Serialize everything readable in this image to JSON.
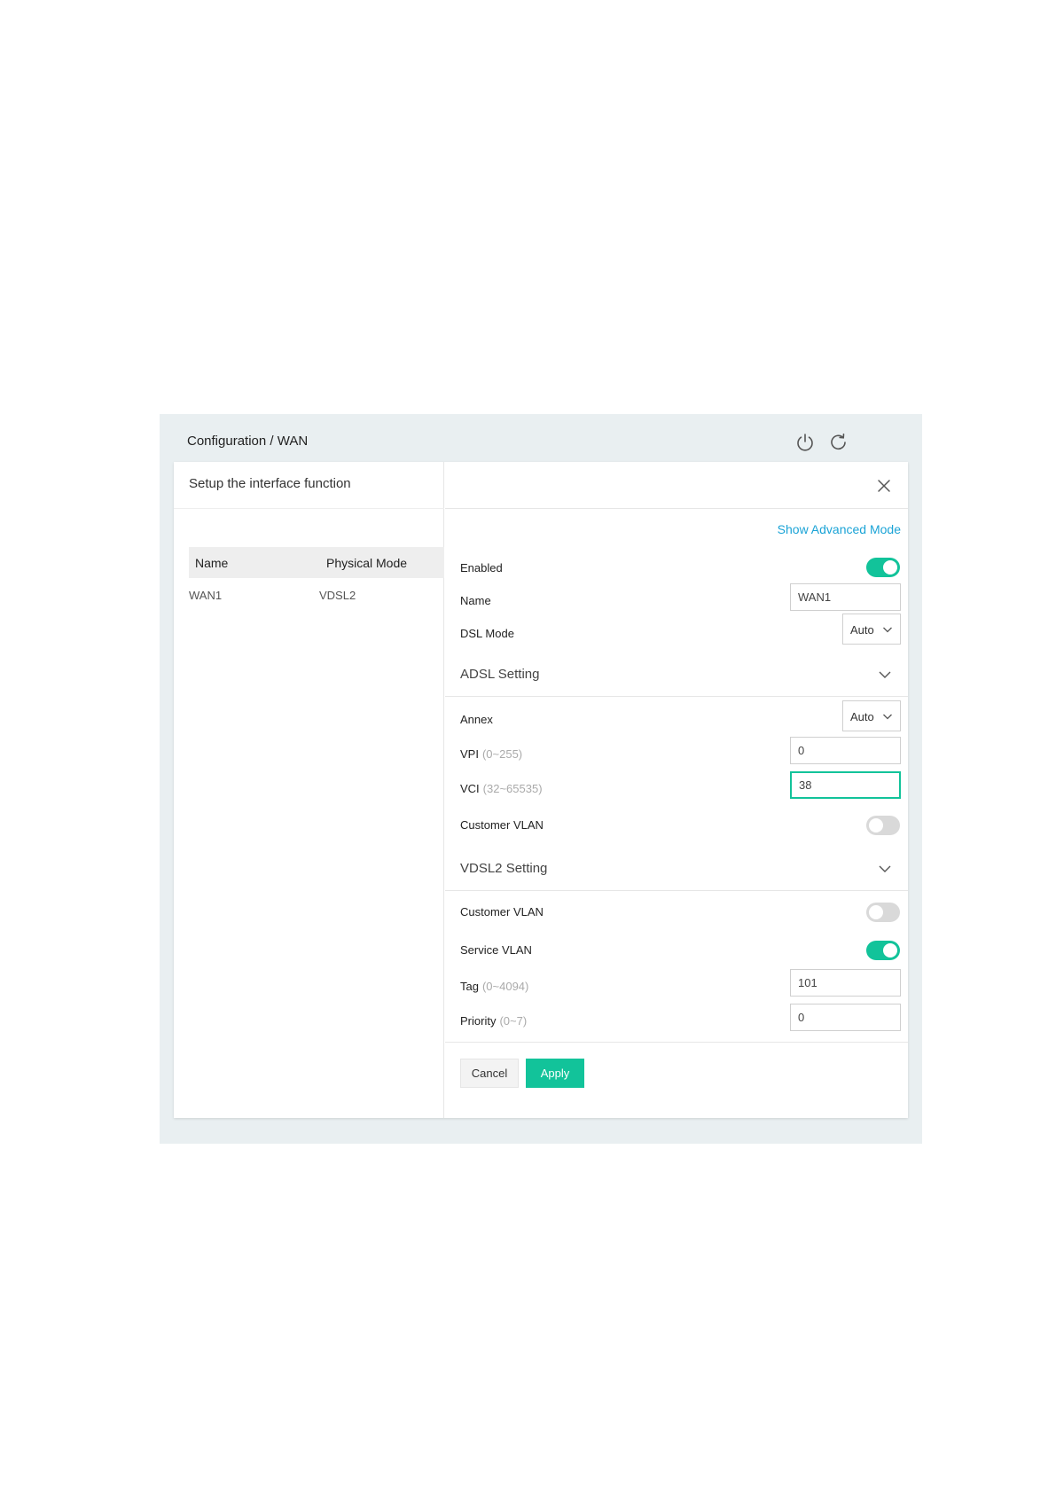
{
  "header": {
    "breadcrumb": "Configuration / WAN",
    "power_icon": "power-icon",
    "refresh_icon": "refresh-icon"
  },
  "left_panel": {
    "title": "Setup the interface function",
    "columns": [
      "Name",
      "Physical Mode"
    ],
    "rows": [
      {
        "name": "WAN1",
        "physical_mode": "VDSL2"
      }
    ]
  },
  "right_panel": {
    "close_icon": "close-icon",
    "advanced_link": "Show Advanced Mode",
    "enabled": {
      "label": "Enabled",
      "state": "on"
    },
    "name": {
      "label": "Name",
      "value": "WAN1"
    },
    "dsl_mode": {
      "label": "DSL Mode",
      "value": "Auto"
    },
    "adsl_section": {
      "title": "ADSL Setting",
      "annex": {
        "label": "Annex",
        "value": "Auto"
      },
      "vpi": {
        "label": "VPI",
        "hint": "(0~255)",
        "value": "0"
      },
      "vci": {
        "label": "VCI",
        "hint": "(32~65535)",
        "value": "38"
      },
      "customer_vlan": {
        "label": "Customer VLAN",
        "state": "off"
      }
    },
    "vdsl2_section": {
      "title": "VDSL2 Setting",
      "customer_vlan": {
        "label": "Customer VLAN",
        "state": "off"
      },
      "service_vlan": {
        "label": "Service VLAN",
        "state": "on"
      },
      "tag": {
        "label": "Tag",
        "hint": "(0~4094)",
        "value": "101"
      },
      "priority": {
        "label": "Priority",
        "hint": "(0~7)",
        "value": "0"
      }
    },
    "buttons": {
      "cancel": "Cancel",
      "apply": "Apply"
    }
  },
  "colors": {
    "accent": "#12c39a",
    "link": "#1aa3d6",
    "toggle_off": "#d9d9d9"
  }
}
